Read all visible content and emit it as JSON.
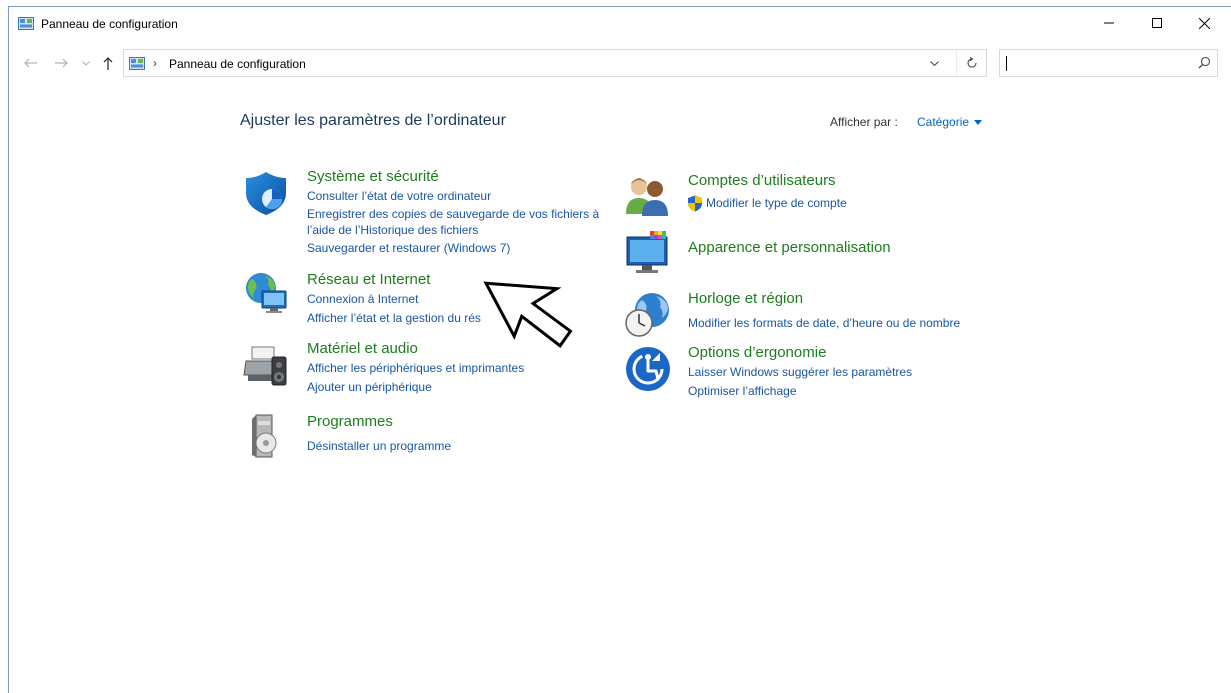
{
  "window": {
    "title": "Panneau de configuration"
  },
  "address": {
    "path": "Panneau de configuration",
    "separator": "›"
  },
  "search": {
    "placeholder": ""
  },
  "main": {
    "heading": "Ajuster les paramètres de l’ordinateur",
    "view_by_label": "Afficher par :",
    "view_by_value": "Catégorie"
  },
  "categories": {
    "system": {
      "title": "Système et sécurité",
      "links": [
        "Consulter l’état de votre ordinateur",
        "Enregistrer des copies de sauvegarde de vos fichiers à",
        "l’aide de l’Historique des fichiers",
        "Sauvegarder et restaurer (Windows 7)"
      ]
    },
    "network": {
      "title": "Réseau et Internet",
      "links": [
        "Connexion à Internet",
        "Afficher l’état et la gestion du rés"
      ]
    },
    "hardware": {
      "title": "Matériel et audio",
      "links": [
        "Afficher les périphériques et imprimantes",
        "Ajouter un périphérique"
      ]
    },
    "programs": {
      "title": "Programmes",
      "links": [
        "Désinstaller un programme"
      ]
    },
    "accounts": {
      "title": "Comptes d’utilisateurs",
      "links": [
        "Modifier le type de compte"
      ]
    },
    "appearance": {
      "title": "Apparence et personnalisation",
      "links": []
    },
    "clock": {
      "title": "Horloge et région",
      "links": [
        "Modifier les formats de date, d’heure ou de nombre"
      ]
    },
    "ease": {
      "title": "Options d’ergonomie",
      "links": [
        "Laisser Windows suggérer les paramètres",
        "Optimiser l’affichage"
      ]
    }
  },
  "icons": {
    "app": "control-panel-icon",
    "minimize": "minimize-icon",
    "maximize": "maximize-icon",
    "close": "close-icon",
    "back": "back-arrow-icon",
    "forward": "forward-arrow-icon",
    "recent": "chevron-down-icon",
    "up": "up-arrow-icon",
    "refresh": "refresh-icon",
    "search": "search-icon",
    "uac_shield": "uac-shield-icon",
    "cursor": "mouse-pointer-icon"
  },
  "colors": {
    "category_title": "#1e7d1e",
    "link": "#1a56a6",
    "heading": "#1e395b",
    "view_by_value": "#0066cc"
  }
}
